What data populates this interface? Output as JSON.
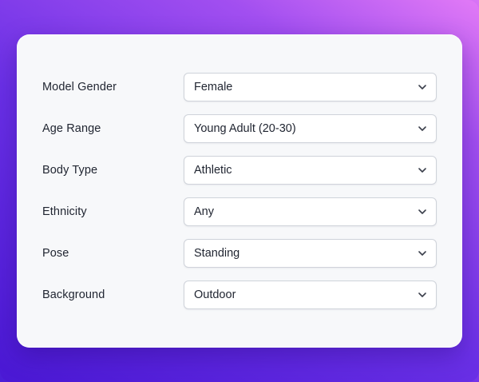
{
  "form": {
    "fields": [
      {
        "label": "Model Gender",
        "value": "Female",
        "icon": "chevron-down-icon"
      },
      {
        "label": "Age Range",
        "value": "Young Adult (20-30)",
        "icon": "chevron-down-icon"
      },
      {
        "label": "Body Type",
        "value": "Athletic",
        "icon": "chevron-down-icon"
      },
      {
        "label": "Ethnicity",
        "value": "Any",
        "icon": "chevron-down-icon"
      },
      {
        "label": "Pose",
        "value": "Standing",
        "icon": "chevron-down-icon"
      },
      {
        "label": "Background",
        "value": "Outdoor",
        "icon": "chevron-down-icon"
      }
    ]
  },
  "colors": {
    "card_background": "#f7f8fa",
    "select_border": "#cfd3da",
    "text": "#1f2430",
    "gradient_start": "#4a18d4",
    "gradient_end": "#e27af6"
  }
}
